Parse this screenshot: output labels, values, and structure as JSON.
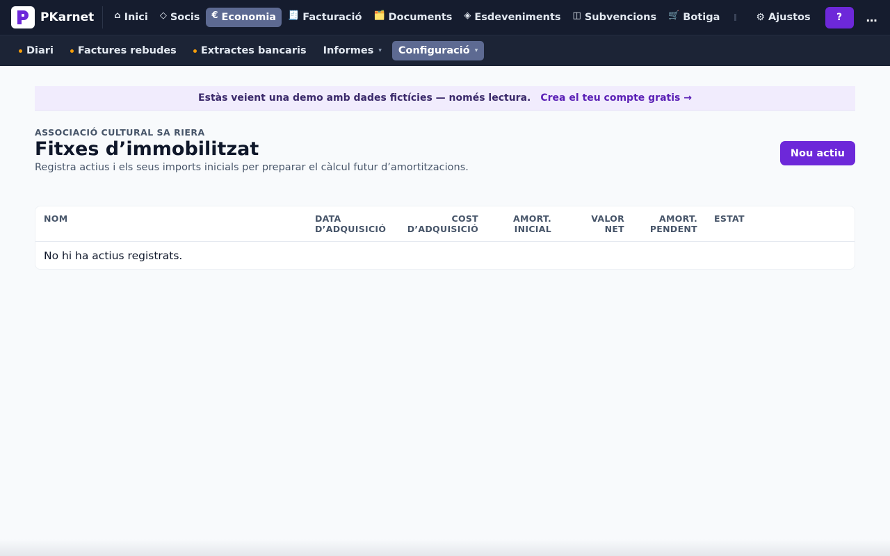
{
  "brand": {
    "name": "PKarnet"
  },
  "nav": [
    {
      "name": "nav-inici",
      "icon": "home-icon",
      "glyph": "⌂",
      "label": "Inici",
      "active": false
    },
    {
      "name": "nav-socis",
      "icon": "diamond-icon",
      "glyph": "◇",
      "label": "Socis",
      "active": false
    },
    {
      "name": "nav-economia",
      "icon": "euro-icon",
      "glyph": "€",
      "label": "Economia",
      "active": true
    },
    {
      "name": "nav-facturacio",
      "icon": "receipt-icon",
      "glyph": "🧾",
      "label": "Facturació",
      "active": false
    },
    {
      "name": "nav-documents",
      "icon": "folder-icon",
      "glyph": "🗂️",
      "label": "Documents",
      "active": false
    },
    {
      "name": "nav-esdeveniments",
      "icon": "diamond-filled-icon",
      "glyph": "◈",
      "label": "Esdeveniments",
      "active": false
    },
    {
      "name": "nav-subvencions",
      "icon": "book-icon",
      "glyph": "◫",
      "label": "Subvencions",
      "active": false
    },
    {
      "name": "nav-botiga",
      "icon": "cart-icon",
      "glyph": "🛒",
      "label": "Botiga",
      "active": false
    }
  ],
  "settings": {
    "label": "Ajustos",
    "glyph": "⚙"
  },
  "help": {
    "label": "?"
  },
  "more": {
    "label": "…"
  },
  "subnav": [
    {
      "name": "subnav-diari",
      "label": "Diari",
      "dot": true,
      "caret": false,
      "active": false
    },
    {
      "name": "subnav-factures-rebudes",
      "label": "Factures rebudes",
      "dot": true,
      "caret": false,
      "active": false
    },
    {
      "name": "subnav-extractes-bancaris",
      "label": "Extractes bancaris",
      "dot": true,
      "caret": false,
      "active": false
    },
    {
      "name": "subnav-informes",
      "label": "Informes",
      "dot": false,
      "caret": true,
      "active": false
    },
    {
      "name": "subnav-configuracio",
      "label": "Configuració",
      "dot": false,
      "caret": true,
      "active": true
    }
  ],
  "caret_glyph": "▾",
  "banner": {
    "text": "Estàs veient una demo amb dades fictícies — només lectura.",
    "link": "Crea el teu compte gratis →"
  },
  "page": {
    "org": "ASSOCIACIÓ CULTURAL SA RIERA",
    "title": "Fitxes d’immobilitzat",
    "subtitle": "Registra actius i els seus imports inicials per preparar el càlcul futur d’amortitzacions.",
    "new_button": "Nou actiu"
  },
  "table": {
    "columns": [
      {
        "name": "col-nom",
        "line1": "NOM",
        "line2": ""
      },
      {
        "name": "col-data",
        "line1": "DATA",
        "line2": "D’ADQUISICIÓ"
      },
      {
        "name": "col-cost",
        "line1": "COST",
        "line2": "D’ADQUISICIÓ"
      },
      {
        "name": "col-amort",
        "line1": "AMORT.",
        "line2": "INICIAL"
      },
      {
        "name": "col-valor",
        "line1": "VALOR",
        "line2": "NET"
      },
      {
        "name": "col-pend",
        "line1": "AMORT.",
        "line2": "PENDENT"
      },
      {
        "name": "col-estat",
        "line1": "ESTAT",
        "line2": ""
      }
    ],
    "empty": "No hi ha actius registrats."
  },
  "colors": {
    "topbar": "#151c2e",
    "subbar": "#1c2436",
    "accent": "#6d28d9",
    "active_nav": "#5d6a92",
    "dot": "#f59e0b"
  }
}
